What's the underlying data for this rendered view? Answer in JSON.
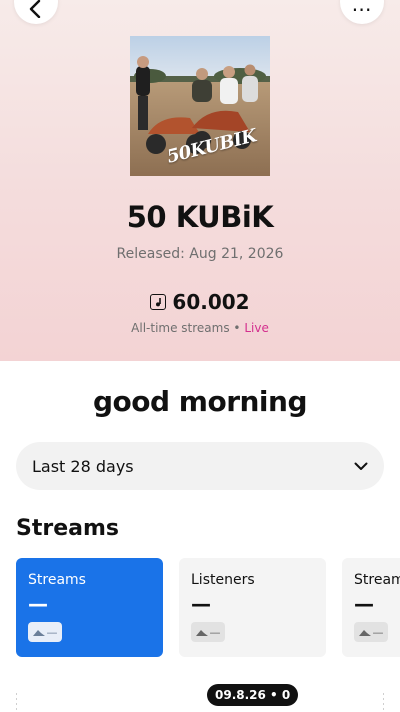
{
  "release": {
    "title": "50 KUBiK",
    "cover_text": "50KUBIK",
    "released": "Released: Aug 21, 2026",
    "streams_count": "60.002",
    "alltime_label": "All-time streams",
    "separator": "•",
    "live_label": "Live"
  },
  "greeting": "good morning",
  "range": {
    "selected": "Last 28 days"
  },
  "stats": {
    "section_title": "Streams",
    "cards": [
      {
        "label": "Streams",
        "value": "—",
        "trend": "—"
      },
      {
        "label": "Listeners",
        "value": "—",
        "trend": "—"
      },
      {
        "label": "Streams",
        "value": "—",
        "trend": "—"
      }
    ]
  },
  "chart": {
    "date_badge": "09.8.26 • 0"
  },
  "colors": {
    "accent": "#1a73e8",
    "live": "#d32f8e",
    "hero_top": "#f7ebe9",
    "hero_bottom": "#f3d3d4"
  },
  "icons": {
    "back": "chevron-left-icon",
    "more": "more-horizontal-icon",
    "streams": "music-note-icon",
    "dropdown": "chevron-down-icon",
    "trend": "mountain-trend-icon"
  }
}
